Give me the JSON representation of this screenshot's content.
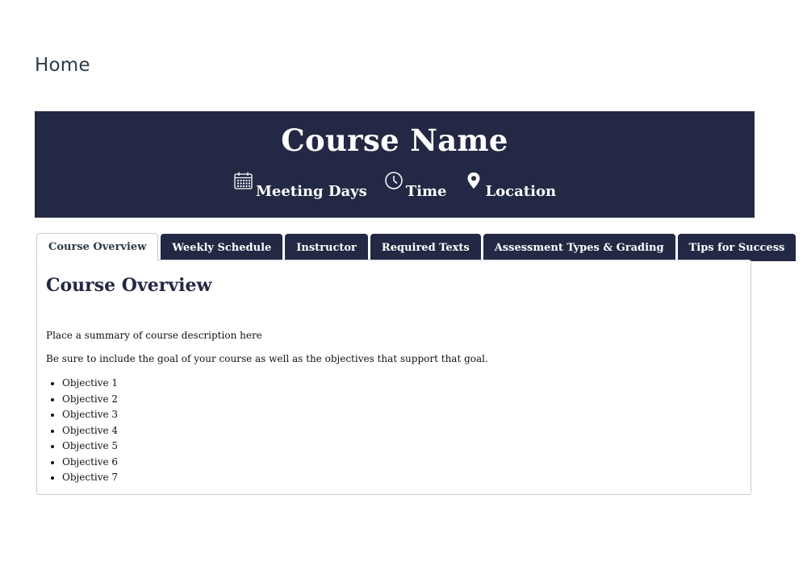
{
  "page": {
    "heading": "Home"
  },
  "banner": {
    "title": "Course Name",
    "meta": [
      {
        "icon": "calendar-icon",
        "label": "Meeting Days"
      },
      {
        "icon": "clock-icon",
        "label": "Time"
      },
      {
        "icon": "map-pin-icon",
        "label": "Location"
      }
    ],
    "background_color": "#232944"
  },
  "tabs": [
    {
      "label": "Course Overview",
      "active": true
    },
    {
      "label": "Weekly Schedule",
      "active": false
    },
    {
      "label": "Instructor",
      "active": false
    },
    {
      "label": "Required Texts",
      "active": false
    },
    {
      "label": "Assessment Types & Grading",
      "active": false
    },
    {
      "label": "Tips for Success",
      "active": false
    }
  ],
  "panel": {
    "title": "Course Overview",
    "summary": "Place a summary of course description here",
    "goal_text": "Be sure to include the goal of your course as well as the objectives that support that goal.",
    "objectives": [
      "Objective 1",
      "Objective 2",
      "Objective 3",
      "Objective 4",
      "Objective 5",
      "Objective 6",
      "Objective 7"
    ]
  }
}
